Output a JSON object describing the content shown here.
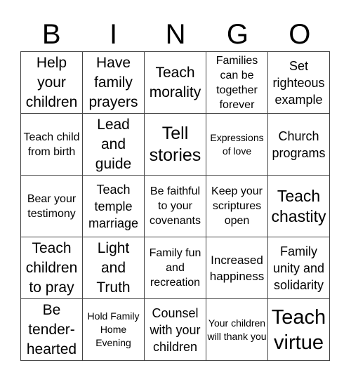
{
  "header": [
    "B",
    "I",
    "N",
    "G",
    "O"
  ],
  "cells": [
    "Help your children",
    "Have family prayers",
    "Teach morality",
    "Families can be together forever",
    "Set righteous example",
    "Teach child from birth",
    "Lead and guide",
    "Tell stories",
    "Expressions of love",
    "Church programs",
    "Bear your testimony",
    "Teach temple marriage",
    "Be faithful to your covenants",
    "Keep your scriptures open",
    "Teach chastity",
    "Teach children to pray",
    "Light and Truth",
    "Family fun and recreation",
    "Increased happiness",
    "Family unity and solidarity",
    "Be tender-hearted",
    "Hold Family Home Evening",
    "Counsel with your children",
    "Your children will thank you",
    "Teach virtue"
  ]
}
